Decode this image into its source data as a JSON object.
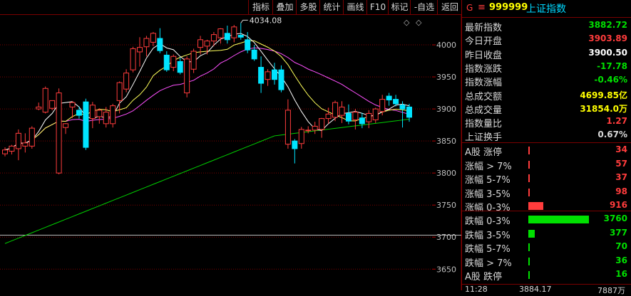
{
  "toolbar": {
    "buttons": [
      "指标",
      "叠加",
      "多股",
      "统计",
      "画线",
      "F10",
      "标记",
      "-自选",
      "返回"
    ]
  },
  "chart": {
    "max_label": "4034.08",
    "corner_icons": [
      "◇",
      "◇"
    ],
    "y_ticks": [
      "4000",
      "3950",
      "3900",
      "3850",
      "3800",
      "3750",
      "3700",
      "3650"
    ]
  },
  "chart_data": {
    "type": "candlestick",
    "y_ticks": [
      4000,
      3950,
      3900,
      3850,
      3800,
      3750,
      3700,
      3650
    ],
    "ylim": [
      3617,
      4050
    ],
    "reference_level": 3703,
    "max_annotation": 4034.08,
    "candles": [
      {
        "o": 3830,
        "h": 3840,
        "l": 3826,
        "c": 3836
      },
      {
        "o": 3834,
        "h": 3844,
        "l": 3829,
        "c": 3842
      },
      {
        "o": 3838,
        "h": 3868,
        "l": 3820,
        "c": 3862
      },
      {
        "o": 3842,
        "h": 3862,
        "l": 3832,
        "c": 3847
      },
      {
        "o": 3842,
        "h": 3873,
        "l": 3838,
        "c": 3870
      },
      {
        "o": 3900,
        "h": 3910,
        "l": 3898,
        "c": 3903
      },
      {
        "o": 3895,
        "h": 3935,
        "l": 3893,
        "c": 3932
      },
      {
        "o": 3901,
        "h": 3912,
        "l": 3898,
        "c": 3913
      },
      {
        "o": 3800,
        "h": 3932,
        "l": 3798,
        "c": 3925
      },
      {
        "o": 3871,
        "h": 3878,
        "l": 3861,
        "c": 3877
      },
      {
        "o": 3903,
        "h": 3912,
        "l": 3886,
        "c": 3910
      },
      {
        "o": 3898,
        "h": 3904,
        "l": 3885,
        "c": 3890
      },
      {
        "o": 3911,
        "h": 3916,
        "l": 3836,
        "c": 3840
      },
      {
        "o": 3885,
        "h": 3911,
        "l": 3870,
        "c": 3906
      },
      {
        "o": 3888,
        "h": 3901,
        "l": 3877,
        "c": 3898
      },
      {
        "o": 3877,
        "h": 3903,
        "l": 3871,
        "c": 3895
      },
      {
        "o": 3877,
        "h": 3908,
        "l": 3871,
        "c": 3905
      },
      {
        "o": 3913,
        "h": 3943,
        "l": 3893,
        "c": 3941
      },
      {
        "o": 3931,
        "h": 3962,
        "l": 3926,
        "c": 3956
      },
      {
        "o": 3961,
        "h": 3997,
        "l": 3957,
        "c": 3994
      },
      {
        "o": 3989,
        "h": 4012,
        "l": 3966,
        "c": 3996
      },
      {
        "o": 3997,
        "h": 4014,
        "l": 3982,
        "c": 4010
      },
      {
        "o": 4004,
        "h": 4020,
        "l": 3998,
        "c": 4018
      },
      {
        "o": 4010,
        "h": 4026,
        "l": 3987,
        "c": 3991
      },
      {
        "o": 3984,
        "h": 3990,
        "l": 3958,
        "c": 3961
      },
      {
        "o": 3965,
        "h": 3985,
        "l": 3959,
        "c": 3982
      },
      {
        "o": 3974,
        "h": 3980,
        "l": 3954,
        "c": 3957
      },
      {
        "o": 3925,
        "h": 3982,
        "l": 3918,
        "c": 3978
      },
      {
        "o": 3962,
        "h": 3994,
        "l": 3956,
        "c": 3990
      },
      {
        "o": 3996,
        "h": 4014,
        "l": 3985,
        "c": 4008
      },
      {
        "o": 3998,
        "h": 4008,
        "l": 3985,
        "c": 4006
      },
      {
        "o": 4006,
        "h": 4020,
        "l": 3998,
        "c": 4016
      },
      {
        "o": 4011,
        "h": 4026,
        "l": 4002,
        "c": 4025
      },
      {
        "o": 4018,
        "h": 4030,
        "l": 4002,
        "c": 4008
      },
      {
        "o": 4011,
        "h": 4031,
        "l": 4004,
        "c": 4028
      },
      {
        "o": 4015,
        "h": 4034.08,
        "l": 4008,
        "c": 4012
      },
      {
        "o": 4008,
        "h": 4020,
        "l": 3987,
        "c": 3992
      },
      {
        "o": 3992,
        "h": 4000,
        "l": 3975,
        "c": 3978
      },
      {
        "o": 3965,
        "h": 3982,
        "l": 3925,
        "c": 3940
      },
      {
        "o": 3946,
        "h": 3962,
        "l": 3936,
        "c": 3958
      },
      {
        "o": 3961,
        "h": 3972,
        "l": 3938,
        "c": 3946
      },
      {
        "o": 3961,
        "h": 3968,
        "l": 3926,
        "c": 3930
      },
      {
        "o": 3845,
        "h": 3915,
        "l": 3838,
        "c": 3898
      },
      {
        "o": 3850,
        "h": 3853,
        "l": 3815,
        "c": 3838
      },
      {
        "o": 3846,
        "h": 3872,
        "l": 3838,
        "c": 3868
      },
      {
        "o": 3866,
        "h": 3873,
        "l": 3862,
        "c": 3867
      },
      {
        "o": 3867,
        "h": 3880,
        "l": 3861,
        "c": 3873
      },
      {
        "o": 3868,
        "h": 3886,
        "l": 3855,
        "c": 3885
      },
      {
        "o": 3885,
        "h": 3902,
        "l": 3877,
        "c": 3892
      },
      {
        "o": 3887,
        "h": 3913,
        "l": 3881,
        "c": 3910
      },
      {
        "o": 3890,
        "h": 3912,
        "l": 3878,
        "c": 3903
      },
      {
        "o": 3893,
        "h": 3907,
        "l": 3876,
        "c": 3881
      },
      {
        "o": 3883,
        "h": 3900,
        "l": 3868,
        "c": 3895
      },
      {
        "o": 3886,
        "h": 3894,
        "l": 3870,
        "c": 3877
      },
      {
        "o": 3880,
        "h": 3898,
        "l": 3870,
        "c": 3893
      },
      {
        "o": 3883,
        "h": 3902,
        "l": 3878,
        "c": 3900
      },
      {
        "o": 3896,
        "h": 3922,
        "l": 3890,
        "c": 3915
      },
      {
        "o": 3920,
        "h": 3925,
        "l": 3905,
        "c": 3914
      },
      {
        "o": 3915,
        "h": 3922,
        "l": 3904,
        "c": 3908
      },
      {
        "o": 3906,
        "h": 3912,
        "l": 3871,
        "c": 3900
      },
      {
        "o": 3903,
        "h": 3908,
        "l": 3880,
        "c": 3887
      }
    ]
  },
  "panel": {
    "header": {
      "g": "G",
      "menu": "≡",
      "code": "999999",
      "name": "上证指数"
    },
    "stats": [
      {
        "label": "最新指数",
        "value": "3882.72",
        "color": "#00e000"
      },
      {
        "label": "今日开盘",
        "value": "3903.89",
        "color": "#ff3c3c"
      },
      {
        "label": "昨日收盘",
        "value": "3900.50",
        "color": "#ffffff"
      },
      {
        "label": "指数涨跌",
        "value": "-17.78",
        "color": "#00e000"
      },
      {
        "label": "指数涨幅",
        "value": "-0.46%",
        "color": "#00e000"
      },
      {
        "label": "总成交额",
        "value": "4699.85亿",
        "color": "#ffff00"
      },
      {
        "label": "总成交量",
        "value": "31854.0万",
        "color": "#ffff00"
      },
      {
        "label": "指数量比",
        "value": "1.27",
        "color": "#ff3c3c"
      },
      {
        "label": "上证换手",
        "value": "0.67%",
        "color": "#d8d8d8"
      }
    ],
    "up_rows": [
      {
        "label": "A股 涨停",
        "value": "34",
        "color": "#ff3c3c",
        "fraction": 0.01
      },
      {
        "label": "涨幅 > 7%",
        "value": "57",
        "color": "#ff3c3c",
        "fraction": 0.01
      },
      {
        "label": "涨幅 5-7%",
        "value": "37",
        "color": "#ff3c3c",
        "fraction": 0.01
      },
      {
        "label": "涨幅 3-5%",
        "value": "98",
        "color": "#ff3c3c",
        "fraction": 0.026
      },
      {
        "label": "涨幅 0-3%",
        "value": "916",
        "color": "#ff3c3c",
        "fraction": 0.244
      }
    ],
    "down_rows": [
      {
        "label": "跌幅 0-3%",
        "value": "3760",
        "color": "#00e000",
        "fraction": 1.0
      },
      {
        "label": "跌幅 3-5%",
        "value": "377",
        "color": "#00e000",
        "fraction": 0.1
      },
      {
        "label": "跌幅 5-7%",
        "value": "70",
        "color": "#00e000",
        "fraction": 0.019
      },
      {
        "label": "跌幅 > 7%",
        "value": "36",
        "color": "#00e000",
        "fraction": 0.01
      },
      {
        "label": "A股 跌停",
        "value": "16",
        "color": "#00e000",
        "fraction": 0.01
      }
    ],
    "cutoff": {
      "time": "11:28",
      "price": "3884.17",
      "vol": "7887万"
    }
  },
  "colors": {
    "up": "#ff3c3c",
    "down": "#00e4ff",
    "ma5": "#ffffff",
    "ma10": "#ffff5a",
    "ma20": "#ff50ff",
    "ma60": "#00d000",
    "grid": "#7a0000"
  }
}
